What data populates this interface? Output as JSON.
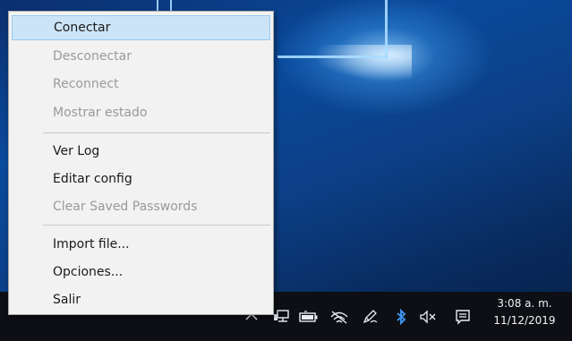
{
  "menu": {
    "items": [
      {
        "label": "Conectar",
        "enabled": true,
        "highlighted": true
      },
      {
        "label": "Desconectar",
        "enabled": false
      },
      {
        "label": "Reconnect",
        "enabled": false
      },
      {
        "label": "Mostrar estado",
        "enabled": false
      },
      {
        "label": "Ver Log",
        "enabled": true
      },
      {
        "label": "Editar config",
        "enabled": true
      },
      {
        "label": "Clear Saved Passwords",
        "enabled": false
      },
      {
        "label": "Import file...",
        "enabled": true
      },
      {
        "label": "Opciones...",
        "enabled": true
      },
      {
        "label": "Salir",
        "enabled": true
      }
    ]
  },
  "taskbar": {
    "tray_icons": [
      "chevron-up-icon",
      "network-computer-icon",
      "battery-icon",
      "wifi-off-icon",
      "pen-icon",
      "bluetooth-icon",
      "volume-muted-icon",
      "notification-icon"
    ],
    "clock": {
      "time": "3:08 a. m.",
      "date": "11/12/2019"
    }
  },
  "colors": {
    "menu_background": "#f2f2f2",
    "menu_highlight": "#cce4f7",
    "taskbar": "#0d0f14",
    "desktop_blue": "#0a4a9c",
    "bluetooth": "#3b8fe8"
  }
}
